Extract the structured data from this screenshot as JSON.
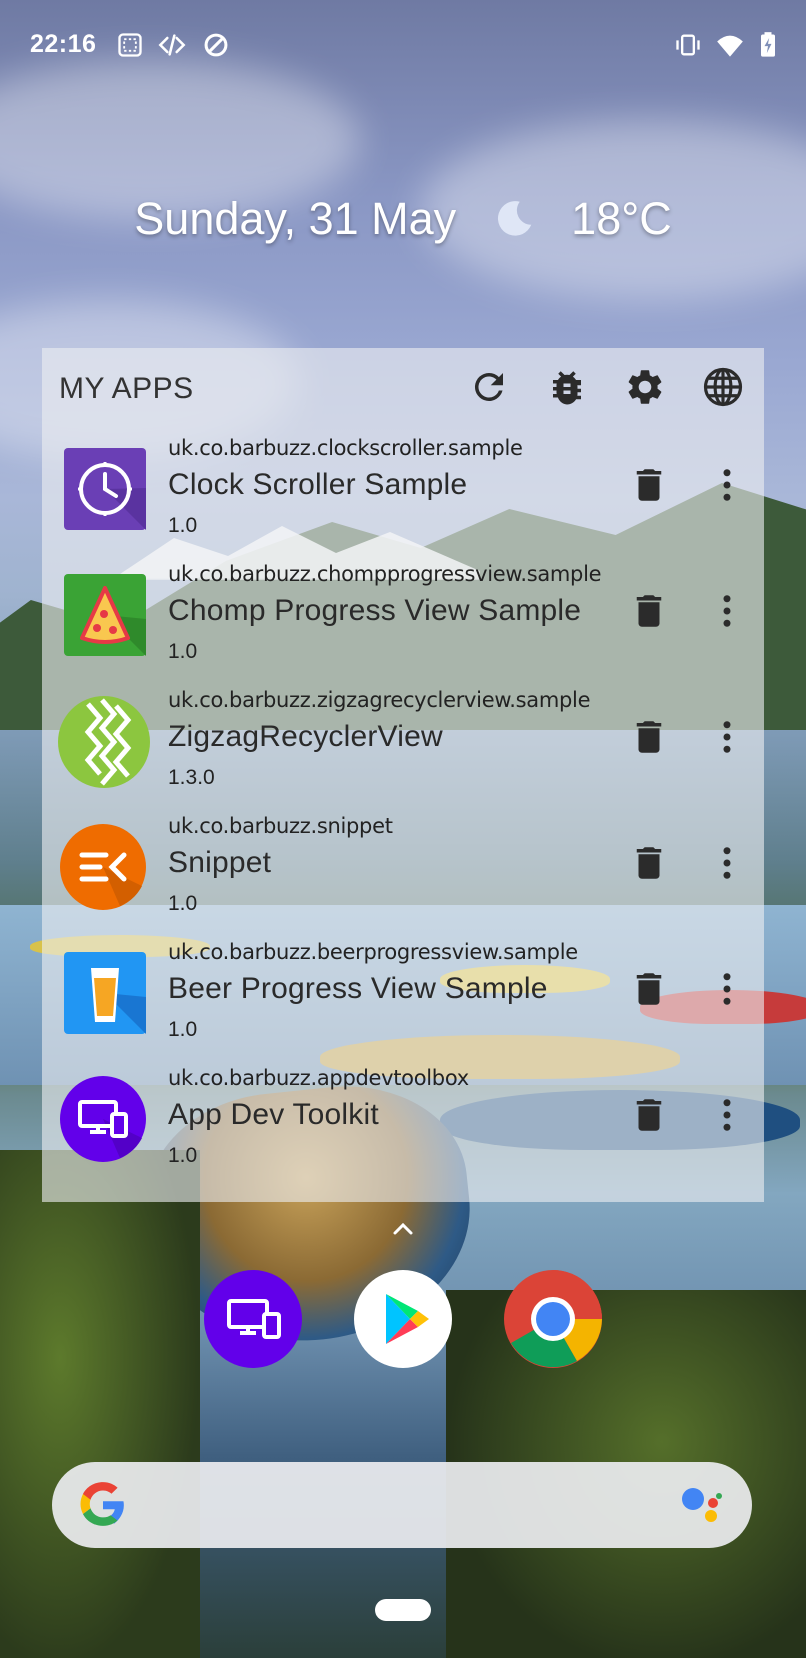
{
  "status_bar": {
    "time": "22:16",
    "left_icons": [
      "screenshot-icon",
      "dev-code-icon",
      "data-saver-icon"
    ],
    "right_icons": [
      "vibrate-icon",
      "wifi-icon",
      "battery-charging-icon"
    ]
  },
  "date_widget": {
    "date": "Sunday, 31 May",
    "weather_icon": "moon-icon",
    "temperature": "18°C"
  },
  "apps_widget": {
    "title": "MY APPS",
    "header_actions": [
      "refresh-icon",
      "bug-icon",
      "settings-icon",
      "globe-icon"
    ],
    "apps": [
      {
        "package": "uk.co.barbuzz.clockscroller.sample",
        "name": "Clock Scroller Sample",
        "version": "1.0",
        "icon": "clock-app-icon"
      },
      {
        "package": "uk.co.barbuzz.chompprogressview.sample",
        "name": "Chomp Progress View Sample",
        "version": "1.0",
        "icon": "pizza-app-icon"
      },
      {
        "package": "uk.co.barbuzz.zigzagrecyclerview.sample",
        "name": "ZigzagRecyclerView",
        "version": "1.3.0",
        "icon": "zigzag-app-icon"
      },
      {
        "package": "uk.co.barbuzz.snippet",
        "name": "Snippet",
        "version": "1.0",
        "icon": "snippet-app-icon"
      },
      {
        "package": "uk.co.barbuzz.beerprogressview.sample",
        "name": "Beer Progress View Sample",
        "version": "1.0",
        "icon": "beer-app-icon"
      },
      {
        "package": "uk.co.barbuzz.appdevtoolbox",
        "name": "App Dev Toolkit",
        "version": "1.0",
        "icon": "devices-app-icon"
      }
    ]
  },
  "dock": {
    "apps": [
      "app-dev-toolkit-icon",
      "play-store-icon",
      "chrome-icon"
    ]
  },
  "search_bar": {
    "left_icon": "google-g-icon",
    "right_icon": "assistant-icon"
  },
  "colors": {
    "icon_dark": "#2b2b2b",
    "clock_purple": "#6a3fb5",
    "pizza_green": "#3aa335",
    "zigzag_green": "#8cc63f",
    "snippet_orange": "#ef6c00",
    "beer_blue": "#2196f3",
    "devtool_purple": "#6200ea"
  }
}
